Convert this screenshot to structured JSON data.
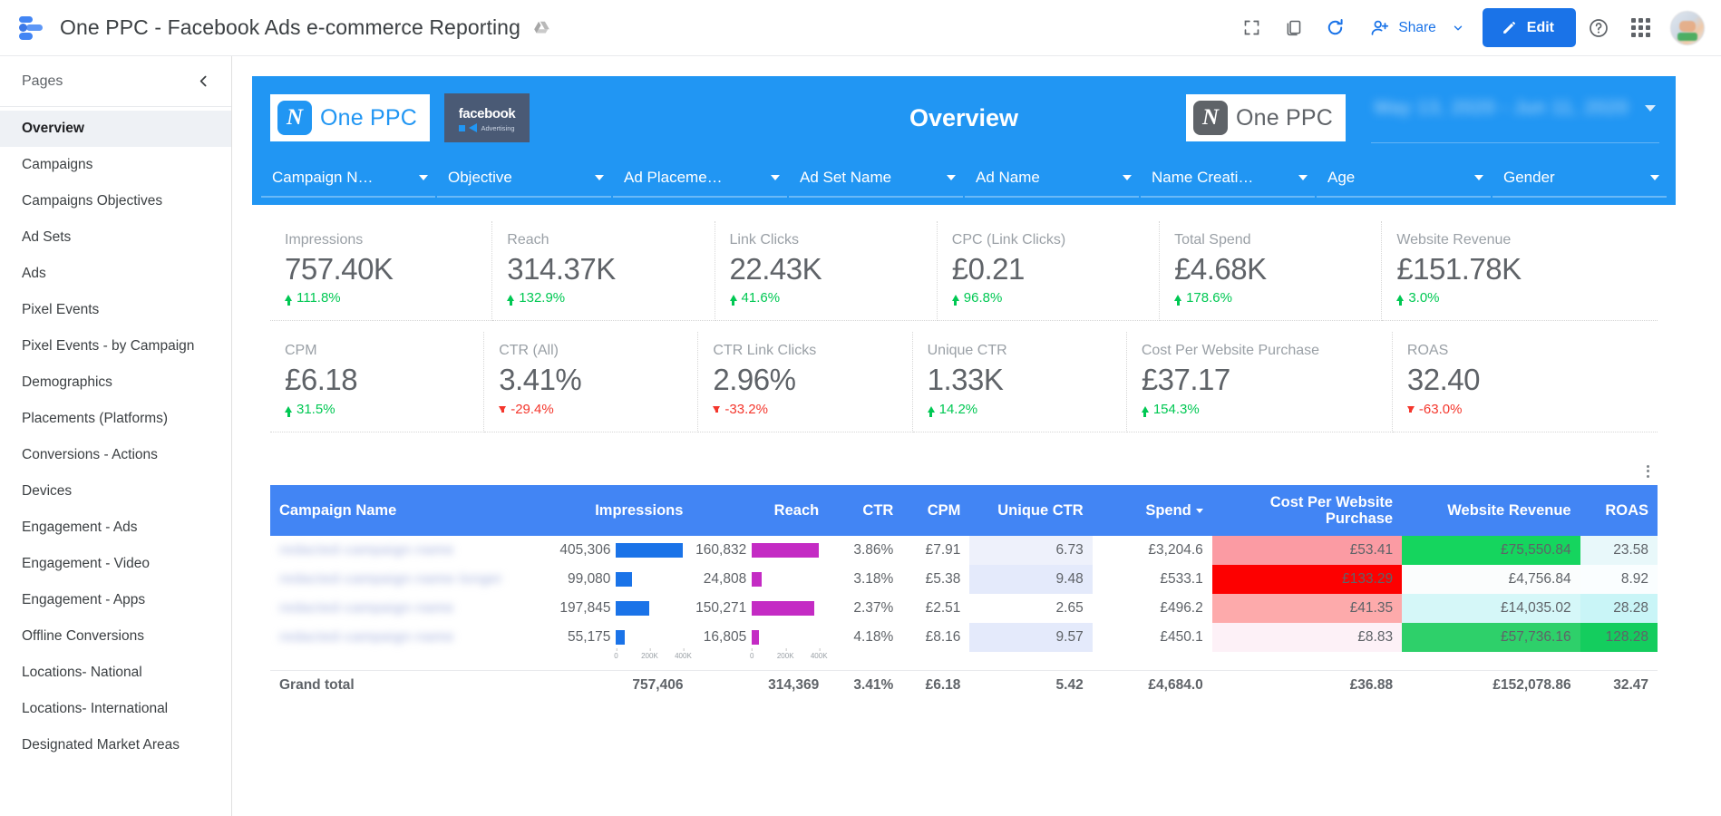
{
  "appbar": {
    "doc_title": "One PPC - Facebook Ads e-commerce Reporting",
    "drive_icon": "drive-icon",
    "fullscreen_icon": "fullscreen-icon",
    "copy_icon": "copy-icon",
    "refresh_icon": "refresh-icon",
    "share_label": "Share",
    "share_icon": "person-add-icon",
    "share_caret_icon": "chevron-down-icon",
    "edit_label": "Edit",
    "edit_icon": "pencil-icon",
    "help_icon": "help-circle-icon",
    "apps_icon": "apps-grid-icon",
    "avatar_icon": "avatar"
  },
  "sidebar": {
    "header": "Pages",
    "collapse_icon": "chevron-left-icon",
    "items": [
      {
        "label": "Overview",
        "active": true
      },
      {
        "label": "Campaigns",
        "active": false
      },
      {
        "label": "Campaigns Objectives",
        "active": false
      },
      {
        "label": "Ad Sets",
        "active": false
      },
      {
        "label": "Ads",
        "active": false
      },
      {
        "label": "Pixel Events",
        "active": false
      },
      {
        "label": "Pixel Events - by Campaign",
        "active": false
      },
      {
        "label": "Demographics",
        "active": false
      },
      {
        "label": "Placements (Platforms)",
        "active": false
      },
      {
        "label": "Conversions - Actions",
        "active": false
      },
      {
        "label": "Devices",
        "active": false
      },
      {
        "label": "Engagement - Ads",
        "active": false
      },
      {
        "label": "Engagement - Video",
        "active": false
      },
      {
        "label": "Engagement - Apps",
        "active": false
      },
      {
        "label": "Offline Conversions",
        "active": false
      },
      {
        "label": "Locations- National",
        "active": false
      },
      {
        "label": "Locations- International",
        "active": false
      },
      {
        "label": "Designated Market Areas",
        "active": false
      }
    ]
  },
  "banner": {
    "title": "Overview",
    "logo_left_text": "One PPC",
    "logo_left_mark": "N",
    "facebook_word": "facebook",
    "facebook_sub": "Advertising",
    "logo_right_text": "One PPC",
    "logo_right_mark": "N",
    "date_range_value": "May 13, 2020 - Jun 11, 2020",
    "date_range_caret": "chevron-down-icon",
    "bg_color": "#2196f3"
  },
  "filters": [
    {
      "label": "Campaign N…",
      "caret": true
    },
    {
      "label": "Objective",
      "caret": true
    },
    {
      "label": "Ad Placeme…",
      "caret": true
    },
    {
      "label": "Ad Set Name",
      "caret": true
    },
    {
      "label": "Ad Name",
      "caret": true
    },
    {
      "label": "Name Creati…",
      "caret": true
    },
    {
      "label": "Age",
      "caret": true
    },
    {
      "label": "Gender",
      "caret": true
    }
  ],
  "scorecards_row1": [
    {
      "title": "Impressions",
      "value": "757.40K",
      "delta": "111.8%",
      "dir": "up",
      "wide": false
    },
    {
      "title": "Reach",
      "value": "314.37K",
      "delta": "132.9%",
      "dir": "up",
      "wide": false
    },
    {
      "title": "Link Clicks",
      "value": "22.43K",
      "delta": "41.6%",
      "dir": "up",
      "wide": false
    },
    {
      "title": "CPC (Link Clicks)",
      "value": "£0.21",
      "delta": "96.8%",
      "dir": "up",
      "wide": false
    },
    {
      "title": "Total Spend",
      "value": "£4.68K",
      "delta": "178.6%",
      "dir": "up",
      "wide": false
    },
    {
      "title": "Website Revenue",
      "value": "£151.78K",
      "delta": "3.0%",
      "dir": "up",
      "wide": true
    }
  ],
  "scorecards_row2": [
    {
      "title": "CPM",
      "value": "£6.18",
      "delta": "31.5%",
      "dir": "up",
      "wide": false
    },
    {
      "title": "CTR (All)",
      "value": "3.41%",
      "delta": "-29.4%",
      "dir": "down",
      "wide": false
    },
    {
      "title": "CTR Link Clicks",
      "value": "2.96%",
      "delta": "-33.2%",
      "dir": "down",
      "wide": false
    },
    {
      "title": "Unique CTR",
      "value": "1.33K",
      "delta": "14.2%",
      "dir": "up",
      "wide": false
    },
    {
      "title": "Cost Per Website Purchase",
      "value": "£37.17",
      "delta": "154.3%",
      "dir": "up",
      "wide": true
    },
    {
      "title": "ROAS",
      "value": "32.40",
      "delta": "-63.0%",
      "dir": "down",
      "wide": true
    }
  ],
  "table": {
    "menu_icon": "more-vert-icon",
    "headers": [
      {
        "label": "Campaign Name",
        "align": "left",
        "sorted": false
      },
      {
        "label": "Impressions",
        "align": "right",
        "sorted": false
      },
      {
        "label": "Reach",
        "align": "right",
        "sorted": false
      },
      {
        "label": "CTR",
        "align": "right",
        "sorted": false
      },
      {
        "label": "CPM",
        "align": "right",
        "sorted": false
      },
      {
        "label": "Unique CTR",
        "align": "right",
        "sorted": false
      },
      {
        "label": "Spend",
        "align": "right",
        "sorted": true
      },
      {
        "label": "Cost Per Website Purchase",
        "align": "right",
        "sorted": false
      },
      {
        "label": "Website Revenue",
        "align": "right",
        "sorted": false
      },
      {
        "label": "ROAS",
        "align": "right",
        "sorted": false
      }
    ],
    "axis_ticks": [
      "0",
      "200K",
      "400K"
    ],
    "rows": [
      {
        "campaign": "redacted-campaign-name",
        "impressions": "405,306",
        "impressions_pct": 100,
        "reach": "160,832",
        "reach_pct": 100,
        "ctr": "3.86%",
        "cpm": "£7.91",
        "unique_ctr": "6.73",
        "unique_ctr_bg": "#eef1fb",
        "spend": "£3,204.6",
        "cost_per_purchase": "£53.41",
        "cost_per_purchase_bg": "#fb9ba3",
        "revenue": "£75,550.84",
        "revenue_bg": "#15d55e",
        "roas": "23.58",
        "roas_bg": "#e8f8fa"
      },
      {
        "campaign": "redacted-campaign-name-longer",
        "impressions": "99,080",
        "impressions_pct": 24,
        "reach": "24,808",
        "reach_pct": 15,
        "ctr": "3.18%",
        "cpm": "£5.38",
        "unique_ctr": "9.48",
        "unique_ctr_bg": "#e4eafb",
        "spend": "£533.1",
        "cost_per_purchase": "£133.29",
        "cost_per_purchase_bg": "#fd0000",
        "revenue": "£4,756.84",
        "revenue_bg": "#fbfdfd",
        "roas": "8.92",
        "roas_bg": "#fafeff"
      },
      {
        "campaign": "redacted-campaign-name",
        "impressions": "197,845",
        "impressions_pct": 49,
        "reach": "150,271",
        "reach_pct": 93,
        "ctr": "2.37%",
        "cpm": "£2.51",
        "unique_ctr": "2.65",
        "unique_ctr_bg": "#ffffff",
        "spend": "£496.2",
        "cost_per_purchase": "£41.35",
        "cost_per_purchase_bg": "#fdaaab",
        "revenue": "£14,035.02",
        "revenue_bg": "#d5f7f8",
        "roas": "28.28",
        "roas_bg": "#c9f5f7"
      },
      {
        "campaign": "redacted-campaign-name",
        "impressions": "55,175",
        "impressions_pct": 13,
        "reach": "16,805",
        "reach_pct": 10,
        "ctr": "4.18%",
        "cpm": "£8.16",
        "unique_ctr": "9.57",
        "unique_ctr_bg": "#e4eafb",
        "spend": "£450.1",
        "cost_per_purchase": "£8.83",
        "cost_per_purchase_bg": "#fdf1f7",
        "revenue": "£57,736.16",
        "revenue_bg": "#2ed06a",
        "roas": "128.28",
        "roas_bg": "#14cd5e"
      }
    ],
    "grand_total": {
      "label": "Grand total",
      "impressions": "757,406",
      "reach": "314,369",
      "ctr": "3.41%",
      "cpm": "£6.18",
      "unique_ctr": "5.42",
      "spend": "£4,684.0",
      "cost_per_purchase": "£36.88",
      "revenue": "£152,078.86",
      "roas": "32.47"
    }
  },
  "colors": {
    "brand_blue": "#2196f3",
    "google_blue": "#1a73e8",
    "table_header": "#4285f4",
    "positive": "#00c853",
    "negative": "#f4362c"
  }
}
